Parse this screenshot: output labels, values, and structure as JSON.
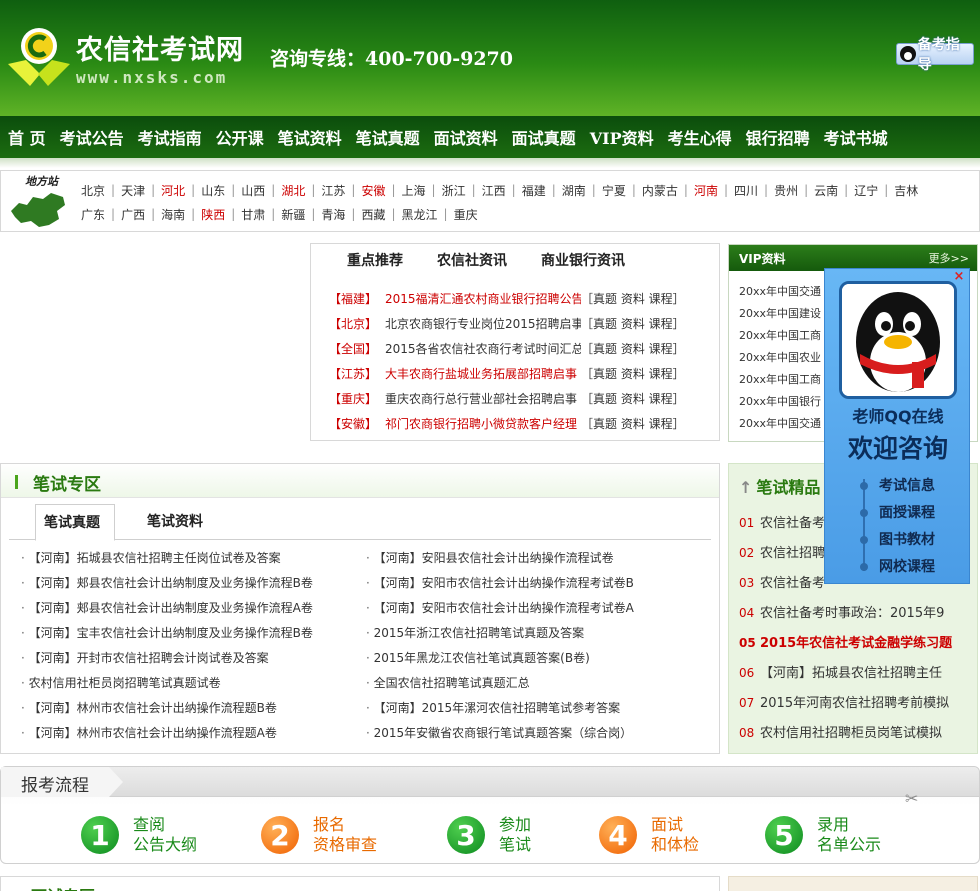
{
  "header": {
    "logo_text": "农信社考试网",
    "logo_url": "www.nxsks.com",
    "hotline": "咨询专线：400-700-9270",
    "guide_button": "备考指导"
  },
  "nav": [
    "首 页",
    "考试公告",
    "考试指南",
    "公开课",
    "笔试资料",
    "笔试真题",
    "面试资料",
    "面试真题",
    "VIP资料",
    "考生心得",
    "银行招聘",
    "考试书城"
  ],
  "regions": {
    "map_label": "地方站",
    "row1": [
      {
        "name": "北京",
        "hot": false
      },
      {
        "name": "天津",
        "hot": false
      },
      {
        "name": "河北",
        "hot": true
      },
      {
        "name": "山东",
        "hot": false
      },
      {
        "name": "山西",
        "hot": false
      },
      {
        "name": "湖北",
        "hot": true
      },
      {
        "name": "江苏",
        "hot": false
      },
      {
        "name": "安徽",
        "hot": true
      },
      {
        "name": "上海",
        "hot": false
      },
      {
        "name": "浙江",
        "hot": false
      },
      {
        "name": "江西",
        "hot": false
      },
      {
        "name": "福建",
        "hot": false
      },
      {
        "name": "湖南",
        "hot": false
      },
      {
        "name": "宁夏",
        "hot": false
      },
      {
        "name": "内蒙古",
        "hot": false
      },
      {
        "name": "河南",
        "hot": true
      },
      {
        "name": "四川",
        "hot": false
      },
      {
        "name": "贵州",
        "hot": false
      },
      {
        "name": "云南",
        "hot": false
      },
      {
        "name": "辽宁",
        "hot": false
      },
      {
        "name": "吉林",
        "hot": false
      }
    ],
    "row2": [
      {
        "name": "广东",
        "hot": false
      },
      {
        "name": "广西",
        "hot": false
      },
      {
        "name": "海南",
        "hot": false
      },
      {
        "name": "陕西",
        "hot": true
      },
      {
        "name": "甘肃",
        "hot": false
      },
      {
        "name": "新疆",
        "hot": false
      },
      {
        "name": "青海",
        "hot": false
      },
      {
        "name": "西藏",
        "hot": false
      },
      {
        "name": "黑龙江",
        "hot": false
      },
      {
        "name": "重庆",
        "hot": false
      }
    ]
  },
  "recommend": {
    "tabs": [
      "重点推荐",
      "农信社资讯",
      "商业银行资讯"
    ],
    "links": "［真题 资料 课程］",
    "items": [
      {
        "region": "【福建】",
        "title": "2015福清汇通农村商业银行招聘公告",
        "red": true
      },
      {
        "region": "【北京】",
        "title": "北京农商银行专业岗位2015招聘启事",
        "red": false
      },
      {
        "region": "【全国】",
        "title": "2015各省农信社农商行考试时间汇总",
        "red": false
      },
      {
        "region": "【江苏】",
        "title": "大丰农商行盐城业务拓展部招聘启事",
        "red": true
      },
      {
        "region": "【重庆】",
        "title": "重庆农商行总行营业部社会招聘启事",
        "red": false
      },
      {
        "region": "【安徽】",
        "title": "祁门农商银行招聘小微贷款客户经理",
        "red": true
      }
    ]
  },
  "vip": {
    "title": "VIP资料",
    "more": "更多>>",
    "items": [
      "20xx年中国交通",
      "20xx年中国建设",
      "20xx年中国工商",
      "20xx年中国农业",
      "20xx年中国工商",
      "20xx年中国银行",
      "20xx年中国交通"
    ]
  },
  "exam": {
    "title": "笔试专区",
    "tabs": [
      "笔试真题",
      "笔试资料"
    ],
    "left": [
      "【河南】拓城县农信社招聘主任岗位试卷及答案",
      "【河南】郏县农信社会计出纳制度及业务操作流程B卷",
      "【河南】郏县农信社会计出纳制度及业务操作流程A卷",
      "【河南】宝丰农信社会计出纳制度及业务操作流程B卷",
      "【河南】开封市农信社招聘会计岗试卷及答案",
      "农村信用社柜员岗招聘笔试真题试卷",
      "【河南】林州市农信社会计出纳操作流程题B卷",
      "【河南】林州市农信社会计出纳操作流程题A卷"
    ],
    "right": [
      "【河南】安阳县农信社会计出纳操作流程试卷",
      "【河南】安阳市农信社会计出纳操作流程考试卷B",
      "【河南】安阳市农信社会计出纳操作流程考试卷A",
      "2015年浙江农信社招聘笔试真题及答案",
      "2015年黑龙江农信社笔试真题答案(B卷)",
      "全国农信社招聘笔试真题汇总",
      "【河南】2015年漯河农信社招聘笔试参考答案",
      "2015年安徽省农商银行笔试真题答案（综合岗）"
    ]
  },
  "best": {
    "title": "笔试精品",
    "items": [
      {
        "num": "01",
        "text": "农信社备考",
        "red": false
      },
      {
        "num": "02",
        "text": "农信社招聘",
        "red": false
      },
      {
        "num": "03",
        "text": "农信社备考",
        "red": false
      },
      {
        "num": "04",
        "text": "农信社备考时事政治：2015年9",
        "red": false
      },
      {
        "num": "05",
        "text": "2015年农信社考试金融学练习题",
        "red": true
      },
      {
        "num": "06",
        "text": "【河南】拓城县农信社招聘主任",
        "red": false
      },
      {
        "num": "07",
        "text": "2015年河南农信社招聘考前模拟",
        "red": false
      },
      {
        "num": "08",
        "text": "农村信用社招聘柜员岗笔试模拟",
        "red": false
      }
    ]
  },
  "qq_float": {
    "close": "×",
    "line1": "老师QQ在线",
    "line2": "欢迎咨询",
    "menu": [
      "考试信息",
      "面授课程",
      "图书教材",
      "网校课程"
    ]
  },
  "process": {
    "title": "报考流程",
    "steps": [
      {
        "num": "1",
        "line1": "查阅",
        "line2": "公告大纲",
        "color": "green"
      },
      {
        "num": "2",
        "line1": "报名",
        "line2": "资格审查",
        "color": "orange"
      },
      {
        "num": "3",
        "line1": "参加",
        "line2": "笔试",
        "color": "green"
      },
      {
        "num": "4",
        "line1": "面试",
        "line2": "和体检",
        "color": "orange"
      },
      {
        "num": "5",
        "line1": "录用",
        "line2": "名单公示",
        "color": "green"
      }
    ]
  },
  "bottom": {
    "left_title": "面试专区"
  }
}
